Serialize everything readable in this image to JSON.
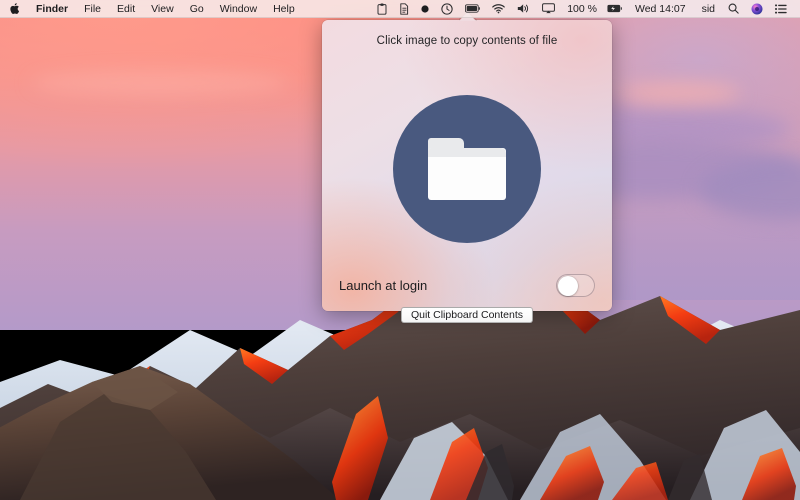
{
  "menubar": {
    "apple_icon": "apple-logo-icon",
    "items": [
      {
        "label": "Finder",
        "bold": true
      },
      {
        "label": "File",
        "bold": false
      },
      {
        "label": "Edit",
        "bold": false
      },
      {
        "label": "View",
        "bold": false
      },
      {
        "label": "Go",
        "bold": false
      },
      {
        "label": "Window",
        "bold": false
      },
      {
        "label": "Help",
        "bold": false
      }
    ],
    "status_icons": [
      {
        "name": "clipboard-icon"
      },
      {
        "name": "document-icon"
      },
      {
        "name": "dot-icon"
      },
      {
        "name": "clock-icon"
      },
      {
        "name": "battery-icon"
      },
      {
        "name": "wifi-icon"
      },
      {
        "name": "volume-icon"
      },
      {
        "name": "airplay-icon"
      }
    ],
    "battery_percent": "100 %",
    "battery_badge_icon": "battery-charged-icon",
    "clock": "Wed 14:07",
    "user": "sid",
    "search_icon": "search-icon",
    "siri_icon": "siri-icon",
    "notification_icon": "notification-center-icon"
  },
  "popover": {
    "title": "Click image to copy contents of file",
    "image_button": {
      "icon": "folder-icon",
      "circle_color": "#49597f",
      "folder_color": "#fdfdfd"
    },
    "launch_at_login": {
      "label": "Launch at login",
      "state": "off"
    },
    "quit_button": {
      "label": "Quit Clipboard Contents"
    }
  },
  "desktop": {
    "wallpaper_name": "macOS Sierra mountains"
  }
}
